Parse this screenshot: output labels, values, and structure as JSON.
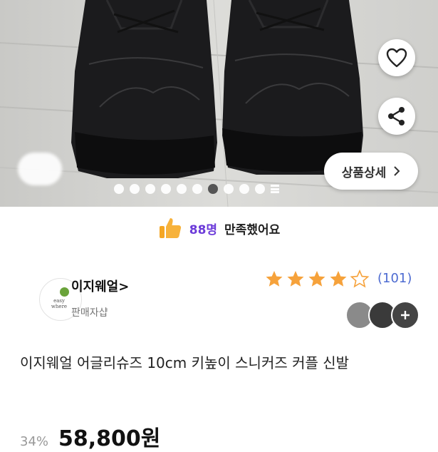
{
  "gallery": {
    "detail_label": "상품상세",
    "dot_count": 10,
    "active_dot_index": 6
  },
  "satisfaction": {
    "count": "88명",
    "text": "만족했어요"
  },
  "seller": {
    "name": "이지웨얼>",
    "subtitle": "판매자샵",
    "logo_line1": "easy",
    "logo_line2": "where"
  },
  "rating": {
    "stars": 4.5,
    "review_count": "(101)"
  },
  "product": {
    "title": "이지웨얼 어글리슈즈 10cm 키높이 스니커즈 커플 신발",
    "discount": "34%",
    "price": "58,800원"
  },
  "colors": {
    "accent_purple": "#6c3bd9",
    "star_orange": "#f6a23b",
    "review_blue": "#4d6bd1"
  }
}
